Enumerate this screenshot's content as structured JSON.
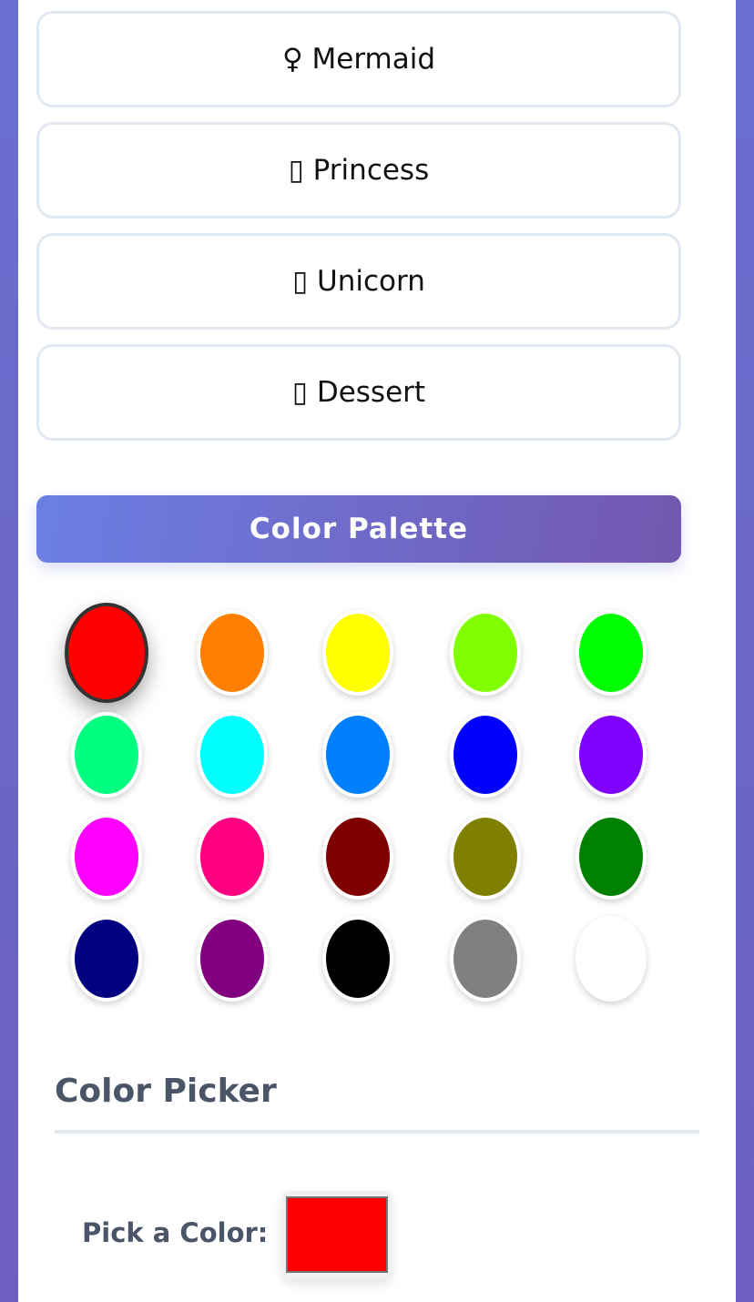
{
  "themes": [
    {
      "label": "‍♀ Mermaid"
    },
    {
      "label": "▯ Princess"
    },
    {
      "label": "▯ Unicorn"
    },
    {
      "label": "▯ Dessert"
    }
  ],
  "palette": {
    "title": "Color Palette",
    "selected_index": 0,
    "colors": [
      "#ff0000",
      "#ff8000",
      "#ffff00",
      "#80ff00",
      "#00ff00",
      "#00ff80",
      "#00ffff",
      "#0080ff",
      "#0000ff",
      "#8000ff",
      "#ff00ff",
      "#ff0080",
      "#800000",
      "#808000",
      "#008000",
      "#000080",
      "#800080",
      "#000000",
      "#808080",
      "#ffffff"
    ]
  },
  "picker": {
    "title": "Color Picker",
    "label": "Pick a Color:",
    "value": "#ff0000"
  }
}
